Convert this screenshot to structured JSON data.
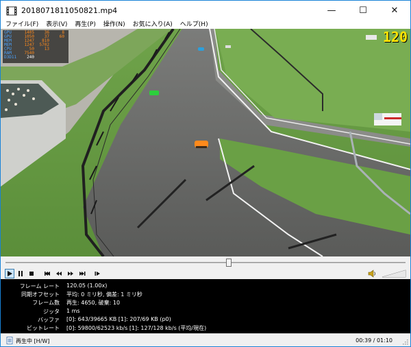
{
  "window": {
    "title": "2018071811050821.mp4",
    "minimize_glyph": "—",
    "maximize_glyph": "☐",
    "close_glyph": "✕"
  },
  "menu": [
    {
      "label": "ファイル(F)"
    },
    {
      "label": "表示(V)"
    },
    {
      "label": "再生(P)"
    },
    {
      "label": "操作(N)"
    },
    {
      "label": "お気に入り(A)"
    },
    {
      "label": "ヘルプ(H)"
    }
  ],
  "osd": {
    "fps_counter": "120",
    "rows": [
      {
        "label": "GPU",
        "a": "1405",
        "b": "36",
        "c": "8"
      },
      {
        "label": "GPU",
        "a": "1050",
        "b": "37",
        "c": "60"
      },
      {
        "label": "MEM",
        "a": "1247",
        "b": "810",
        "c": ""
      },
      {
        "label": "MEM",
        "a": "1247",
        "b": "5702",
        "c": ""
      },
      {
        "label": "CPU",
        "a": "50",
        "b": "13",
        "c": ""
      },
      {
        "label": "RAM",
        "a": "7540",
        "b": "",
        "c": ""
      },
      {
        "label": "D3D11",
        "a": "240",
        "b": "",
        "c": ""
      }
    ]
  },
  "playback": {
    "position_fraction": 0.559,
    "volume_fraction": 1.0
  },
  "controls": [
    {
      "name": "play-button",
      "icon": "play-icon"
    },
    {
      "name": "pause-button",
      "icon": "pause-icon"
    },
    {
      "name": "stop-button",
      "icon": "stop-icon"
    },
    {
      "name": "previous-button",
      "icon": "skip-back-icon"
    },
    {
      "name": "rewind-button",
      "icon": "rewind-icon"
    },
    {
      "name": "forward-button",
      "icon": "fast-forward-icon"
    },
    {
      "name": "next-button",
      "icon": "skip-forward-icon"
    },
    {
      "name": "frame-step-button",
      "icon": "frame-step-icon"
    }
  ],
  "stats": [
    {
      "key": "フレーム レート",
      "value": "120.05 (1.00x)"
    },
    {
      "key": "同期オフセット",
      "value": "平均: 0 ミリ秒, 偏差: 1 ミリ秒"
    },
    {
      "key": "フレーム数",
      "value": "再生: 4650, 破棄: 10"
    },
    {
      "key": "ジッタ",
      "value": "1 ms"
    },
    {
      "key": "バッファ",
      "value": "[0]: 643/39665 KB [1]: 207/69 KB (p0)"
    },
    {
      "key": "ビットレート",
      "value": "[0]: 59800/62523 kb/s [1]: 127/128 kb/s (平均/現在)"
    }
  ],
  "status": {
    "state_text": "再生中 [H/W]",
    "time_text": "00:39 / 01:10"
  },
  "colors": {
    "accent": "#1883d7",
    "fps": "#ffe400",
    "osd_label": "#4aa3ff",
    "osd_value": "#ff8a1c"
  }
}
